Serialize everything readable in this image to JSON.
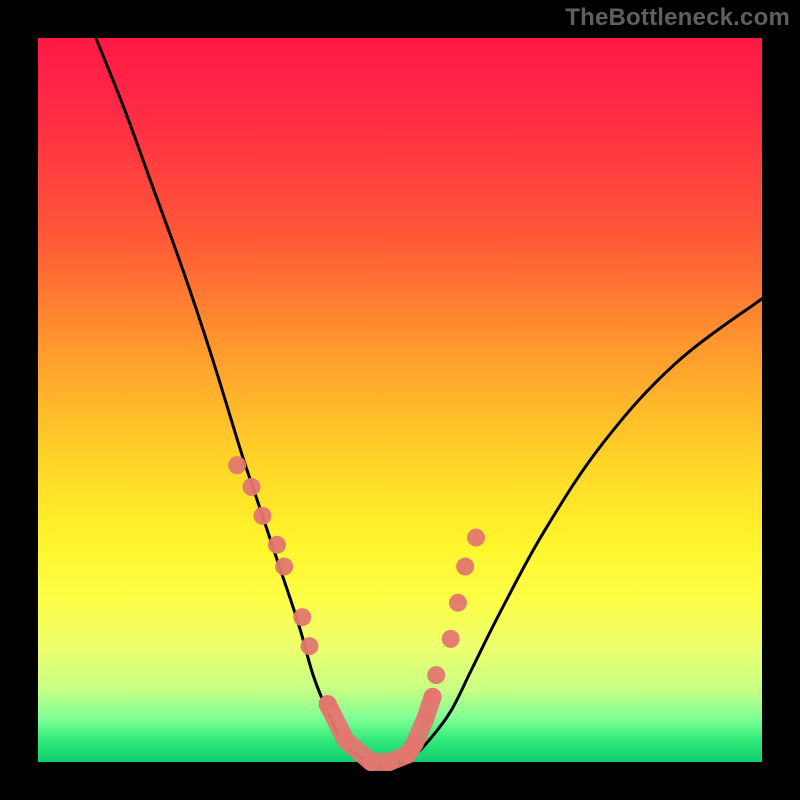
{
  "watermark": "TheBottleneck.com",
  "colors": {
    "background": "#000000",
    "curve_stroke": "#000000",
    "marker_fill": "#e3776f",
    "marker_stroke": "#e3776f",
    "gradient_top": "#ff1946",
    "gradient_bottom": "#0fce6c"
  },
  "chart_data": {
    "type": "line",
    "title": "",
    "xlabel": "",
    "ylabel": "",
    "xlim": [
      0,
      100
    ],
    "ylim": [
      0,
      100
    ],
    "series": [
      {
        "name": "bottleneck-curve",
        "x": [
          8,
          12,
          16,
          20,
          24,
          28,
          30,
          33,
          36,
          38,
          40,
          42,
          44,
          46,
          48,
          50,
          52,
          54,
          57,
          60,
          64,
          70,
          78,
          88,
          100
        ],
        "values": [
          100,
          90,
          79,
          68,
          56,
          43,
          37,
          28,
          19,
          12,
          7,
          3,
          1,
          0,
          0,
          0,
          1,
          3,
          7,
          13,
          21,
          32,
          44,
          55,
          64
        ]
      }
    ],
    "markers": {
      "name": "highlight-points",
      "x": [
        27.5,
        29.5,
        31.0,
        33.0,
        34.0,
        36.5,
        37.5,
        40.0,
        42.5,
        46.0,
        48.5,
        51.0,
        52.0,
        53.5,
        54.5,
        55.0,
        57.0,
        58.0,
        59.0,
        60.5
      ],
      "values": [
        41,
        38,
        34,
        30,
        27,
        20,
        16,
        8,
        3,
        0,
        0,
        1,
        2.5,
        6,
        9,
        12,
        17,
        22,
        27,
        31
      ]
    },
    "marker_radius": 9
  }
}
